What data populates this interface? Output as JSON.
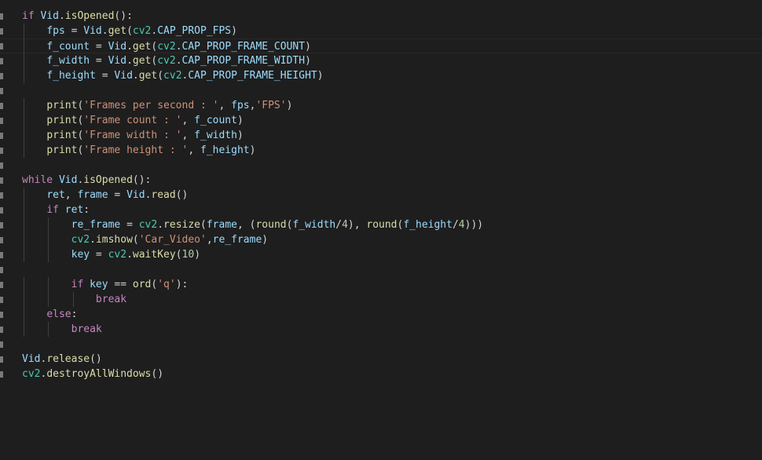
{
  "lines": [
    [
      {
        "t": "if",
        "c": "kw"
      },
      {
        "t": " ",
        "c": "op"
      },
      {
        "t": "Vid",
        "c": "id"
      },
      {
        "t": ".",
        "c": "op"
      },
      {
        "t": "isOpened",
        "c": "fn"
      },
      {
        "t": "():",
        "c": "op"
      }
    ],
    [
      {
        "t": "    ",
        "c": "op"
      },
      {
        "t": "fps",
        "c": "id"
      },
      {
        "t": " = ",
        "c": "op"
      },
      {
        "t": "Vid",
        "c": "id"
      },
      {
        "t": ".",
        "c": "op"
      },
      {
        "t": "get",
        "c": "fn"
      },
      {
        "t": "(",
        "c": "op"
      },
      {
        "t": "cv2",
        "c": "cls"
      },
      {
        "t": ".",
        "c": "op"
      },
      {
        "t": "CAP_PROP_FPS",
        "c": "const"
      },
      {
        "t": ")",
        "c": "op"
      }
    ],
    [
      {
        "t": "    ",
        "c": "op"
      },
      {
        "t": "f_count",
        "c": "id"
      },
      {
        "t": " = ",
        "c": "op"
      },
      {
        "t": "Vid",
        "c": "id"
      },
      {
        "t": ".",
        "c": "op"
      },
      {
        "t": "get",
        "c": "fn"
      },
      {
        "t": "(",
        "c": "op"
      },
      {
        "t": "cv2",
        "c": "cls"
      },
      {
        "t": ".",
        "c": "op"
      },
      {
        "t": "CAP_PROP_FRAME_COUNT",
        "c": "const"
      },
      {
        "t": ")",
        "c": "op"
      }
    ],
    [
      {
        "t": "    ",
        "c": "op"
      },
      {
        "t": "f_width",
        "c": "id"
      },
      {
        "t": " = ",
        "c": "op"
      },
      {
        "t": "Vid",
        "c": "id"
      },
      {
        "t": ".",
        "c": "op"
      },
      {
        "t": "get",
        "c": "fn"
      },
      {
        "t": "(",
        "c": "op"
      },
      {
        "t": "cv2",
        "c": "cls"
      },
      {
        "t": ".",
        "c": "op"
      },
      {
        "t": "CAP_PROP_FRAME_WIDTH",
        "c": "const"
      },
      {
        "t": ")",
        "c": "op"
      }
    ],
    [
      {
        "t": "    ",
        "c": "op"
      },
      {
        "t": "f_height",
        "c": "id"
      },
      {
        "t": " = ",
        "c": "op"
      },
      {
        "t": "Vid",
        "c": "id"
      },
      {
        "t": ".",
        "c": "op"
      },
      {
        "t": "get",
        "c": "fn"
      },
      {
        "t": "(",
        "c": "op"
      },
      {
        "t": "cv2",
        "c": "cls"
      },
      {
        "t": ".",
        "c": "op"
      },
      {
        "t": "CAP_PROP_FRAME_HEIGHT",
        "c": "const"
      },
      {
        "t": ")",
        "c": "op"
      }
    ],
    [],
    [
      {
        "t": "    ",
        "c": "op"
      },
      {
        "t": "print",
        "c": "fn"
      },
      {
        "t": "(",
        "c": "op"
      },
      {
        "t": "'Frames per second : '",
        "c": "str"
      },
      {
        "t": ", ",
        "c": "op"
      },
      {
        "t": "fps",
        "c": "id"
      },
      {
        "t": ",",
        "c": "op"
      },
      {
        "t": "'FPS'",
        "c": "str"
      },
      {
        "t": ")",
        "c": "op"
      }
    ],
    [
      {
        "t": "    ",
        "c": "op"
      },
      {
        "t": "print",
        "c": "fn"
      },
      {
        "t": "(",
        "c": "op"
      },
      {
        "t": "'Frame count : '",
        "c": "str"
      },
      {
        "t": ", ",
        "c": "op"
      },
      {
        "t": "f_count",
        "c": "id"
      },
      {
        "t": ")",
        "c": "op"
      }
    ],
    [
      {
        "t": "    ",
        "c": "op"
      },
      {
        "t": "print",
        "c": "fn"
      },
      {
        "t": "(",
        "c": "op"
      },
      {
        "t": "'Frame width : '",
        "c": "str"
      },
      {
        "t": ", ",
        "c": "op"
      },
      {
        "t": "f_width",
        "c": "id"
      },
      {
        "t": ")",
        "c": "op"
      }
    ],
    [
      {
        "t": "    ",
        "c": "op"
      },
      {
        "t": "print",
        "c": "fn"
      },
      {
        "t": "(",
        "c": "op"
      },
      {
        "t": "'Frame height : '",
        "c": "str"
      },
      {
        "t": ", ",
        "c": "op"
      },
      {
        "t": "f_height",
        "c": "id"
      },
      {
        "t": ")",
        "c": "op"
      }
    ],
    [],
    [
      {
        "t": "while",
        "c": "kw"
      },
      {
        "t": " ",
        "c": "op"
      },
      {
        "t": "Vid",
        "c": "id"
      },
      {
        "t": ".",
        "c": "op"
      },
      {
        "t": "isOpened",
        "c": "fn"
      },
      {
        "t": "():",
        "c": "op"
      }
    ],
    [
      {
        "t": "    ",
        "c": "op"
      },
      {
        "t": "ret",
        "c": "id"
      },
      {
        "t": ", ",
        "c": "op"
      },
      {
        "t": "frame",
        "c": "id"
      },
      {
        "t": " = ",
        "c": "op"
      },
      {
        "t": "Vid",
        "c": "id"
      },
      {
        "t": ".",
        "c": "op"
      },
      {
        "t": "read",
        "c": "fn"
      },
      {
        "t": "()",
        "c": "op"
      }
    ],
    [
      {
        "t": "    ",
        "c": "op"
      },
      {
        "t": "if",
        "c": "kw"
      },
      {
        "t": " ",
        "c": "op"
      },
      {
        "t": "ret",
        "c": "id"
      },
      {
        "t": ":",
        "c": "op"
      }
    ],
    [
      {
        "t": "        ",
        "c": "op"
      },
      {
        "t": "re_frame",
        "c": "id"
      },
      {
        "t": " = ",
        "c": "op"
      },
      {
        "t": "cv2",
        "c": "cls"
      },
      {
        "t": ".",
        "c": "op"
      },
      {
        "t": "resize",
        "c": "fn"
      },
      {
        "t": "(",
        "c": "op"
      },
      {
        "t": "frame",
        "c": "id"
      },
      {
        "t": ", (",
        "c": "op"
      },
      {
        "t": "round",
        "c": "fn"
      },
      {
        "t": "(",
        "c": "op"
      },
      {
        "t": "f_width",
        "c": "id"
      },
      {
        "t": "/",
        "c": "op"
      },
      {
        "t": "4",
        "c": "num"
      },
      {
        "t": "), ",
        "c": "op"
      },
      {
        "t": "round",
        "c": "fn"
      },
      {
        "t": "(",
        "c": "op"
      },
      {
        "t": "f_height",
        "c": "id"
      },
      {
        "t": "/",
        "c": "op"
      },
      {
        "t": "4",
        "c": "num"
      },
      {
        "t": ")))",
        "c": "op"
      }
    ],
    [
      {
        "t": "        ",
        "c": "op"
      },
      {
        "t": "cv2",
        "c": "cls"
      },
      {
        "t": ".",
        "c": "op"
      },
      {
        "t": "imshow",
        "c": "fn"
      },
      {
        "t": "(",
        "c": "op"
      },
      {
        "t": "'Car_Video'",
        "c": "str"
      },
      {
        "t": ",",
        "c": "op"
      },
      {
        "t": "re_frame",
        "c": "id"
      },
      {
        "t": ")",
        "c": "op"
      }
    ],
    [
      {
        "t": "        ",
        "c": "op"
      },
      {
        "t": "key",
        "c": "id"
      },
      {
        "t": " = ",
        "c": "op"
      },
      {
        "t": "cv2",
        "c": "cls"
      },
      {
        "t": ".",
        "c": "op"
      },
      {
        "t": "waitKey",
        "c": "fn"
      },
      {
        "t": "(",
        "c": "op"
      },
      {
        "t": "10",
        "c": "num"
      },
      {
        "t": ")",
        "c": "op"
      }
    ],
    [],
    [
      {
        "t": "        ",
        "c": "op"
      },
      {
        "t": "if",
        "c": "kw"
      },
      {
        "t": " ",
        "c": "op"
      },
      {
        "t": "key",
        "c": "id"
      },
      {
        "t": " == ",
        "c": "op"
      },
      {
        "t": "ord",
        "c": "fn"
      },
      {
        "t": "(",
        "c": "op"
      },
      {
        "t": "'q'",
        "c": "str"
      },
      {
        "t": "):",
        "c": "op"
      }
    ],
    [
      {
        "t": "            ",
        "c": "op"
      },
      {
        "t": "break",
        "c": "kw"
      }
    ],
    [
      {
        "t": "    ",
        "c": "op"
      },
      {
        "t": "else",
        "c": "kw"
      },
      {
        "t": ":",
        "c": "op"
      }
    ],
    [
      {
        "t": "        ",
        "c": "op"
      },
      {
        "t": "break",
        "c": "kw"
      }
    ],
    [],
    [
      {
        "t": "Vid",
        "c": "id"
      },
      {
        "t": ".",
        "c": "op"
      },
      {
        "t": "release",
        "c": "fn"
      },
      {
        "t": "()",
        "c": "op"
      }
    ],
    [
      {
        "t": "cv2",
        "c": "cls"
      },
      {
        "t": ".",
        "c": "op"
      },
      {
        "t": "destroyAllWindows",
        "c": "fn"
      },
      {
        "t": "()",
        "c": "op"
      }
    ]
  ]
}
